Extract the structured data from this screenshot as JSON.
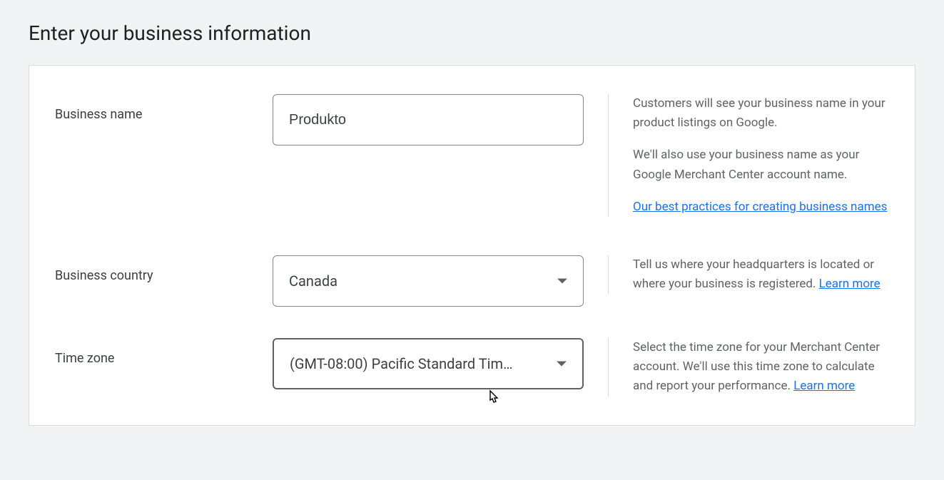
{
  "page": {
    "title": "Enter your business information"
  },
  "fields": {
    "businessName": {
      "label": "Business name",
      "value": "Produkto",
      "help1": "Customers will see your business name in your product listings on Google.",
      "help2": "We'll also use your business name as your Google Merchant Center account name.",
      "link": "Our best practices for creating business names"
    },
    "businessCountry": {
      "label": "Business country",
      "value": "Canada",
      "help": "Tell us where your headquarters is located or where your business is registered. ",
      "link": "Learn more"
    },
    "timeZone": {
      "label": "Time zone",
      "value": "(GMT-08:00) Pacific Standard Tim…",
      "help": "Select the time zone for your Merchant Center account. We'll use this time zone to calculate and report your performance. ",
      "link": "Learn more"
    }
  }
}
